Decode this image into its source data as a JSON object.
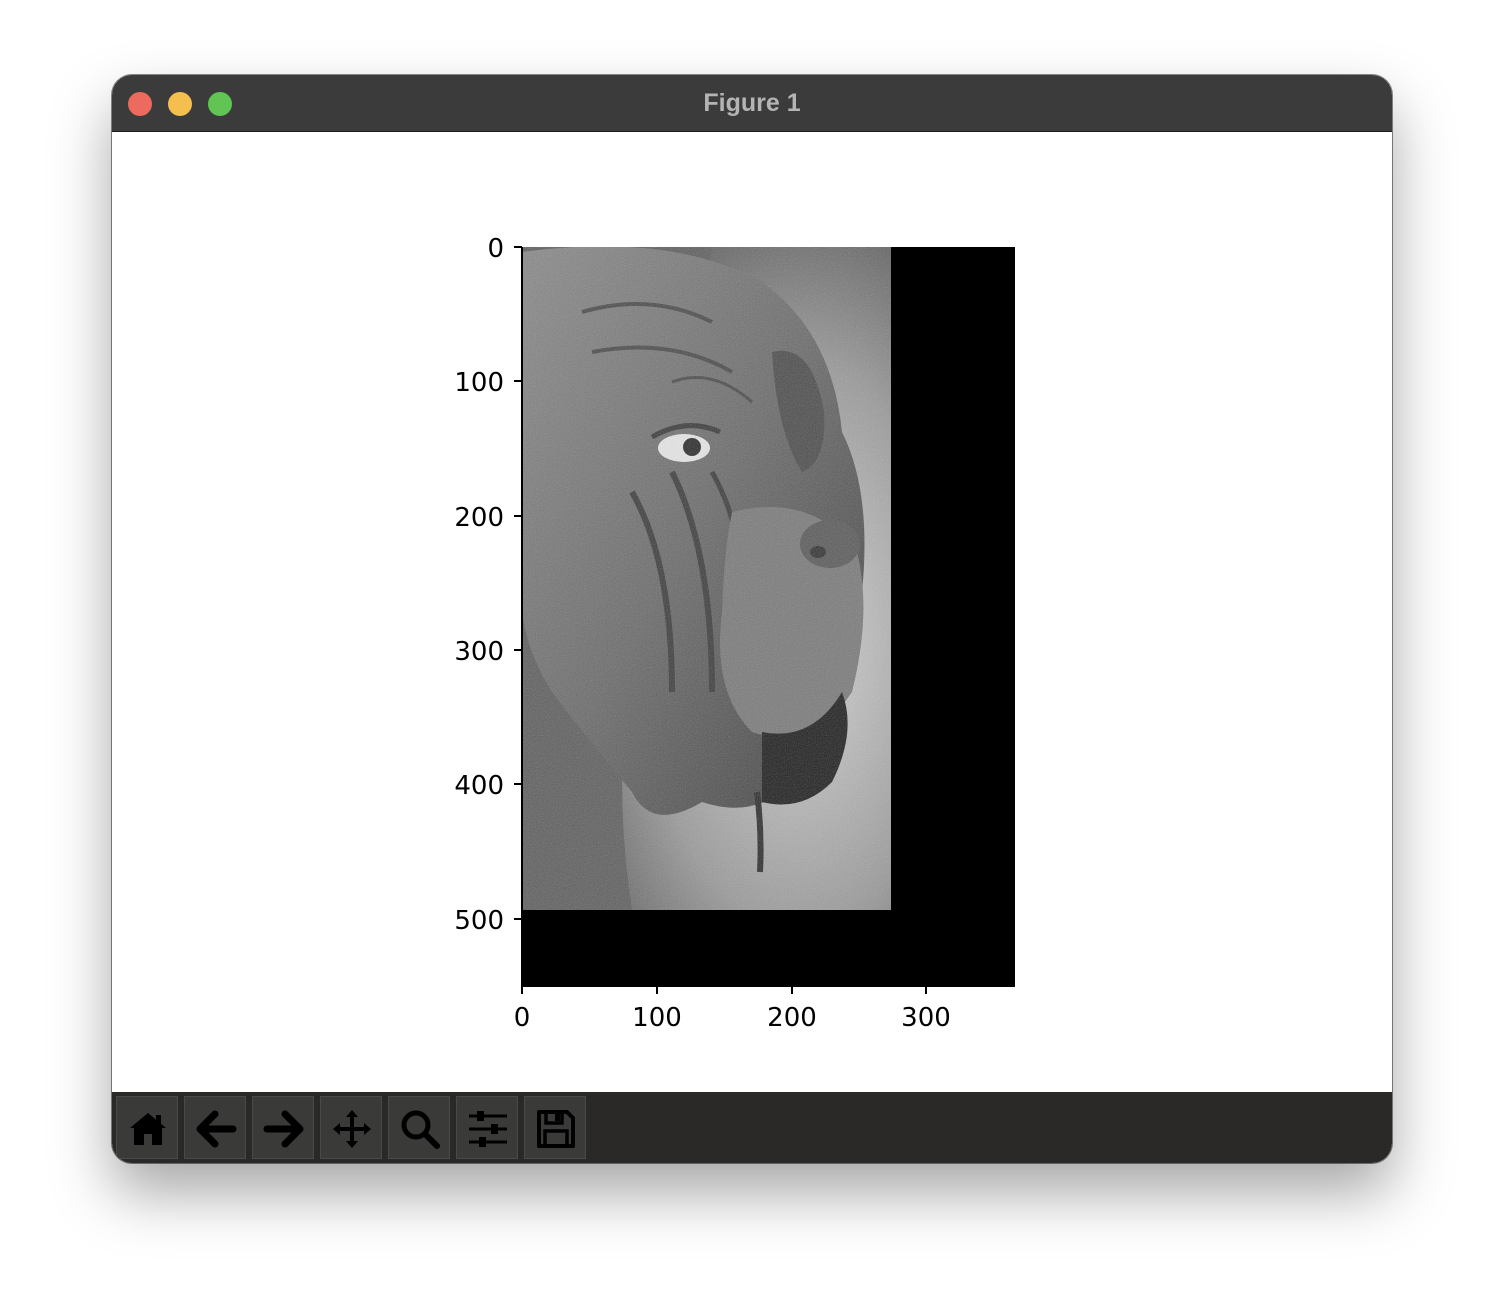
{
  "window": {
    "title": "Figure 1",
    "controls": {
      "close_color": "#ec6a5e",
      "minimize_color": "#f4bf4f",
      "maximize_color": "#61c554"
    }
  },
  "toolbar": {
    "buttons": [
      {
        "name": "home",
        "icon": "home-icon"
      },
      {
        "name": "back",
        "icon": "arrow-left-icon"
      },
      {
        "name": "forward",
        "icon": "arrow-right-icon"
      },
      {
        "name": "pan",
        "icon": "move-icon"
      },
      {
        "name": "zoom",
        "icon": "magnifier-icon"
      },
      {
        "name": "configure-subplots",
        "icon": "sliders-icon"
      },
      {
        "name": "save",
        "icon": "floppy-disk-icon"
      }
    ]
  },
  "figure": {
    "image_subject": "grayscale close-up of a mastiff dog face, padded with black on right and bottom",
    "x_ticks": [
      "0",
      "100",
      "200",
      "300"
    ],
    "y_ticks": [
      "0",
      "100",
      "200",
      "300",
      "400",
      "500"
    ],
    "x_range": [
      0,
      366
    ],
    "y_range": [
      0,
      550
    ],
    "image_extent": {
      "width": 275,
      "height": 495
    },
    "background_color": "#000000"
  }
}
